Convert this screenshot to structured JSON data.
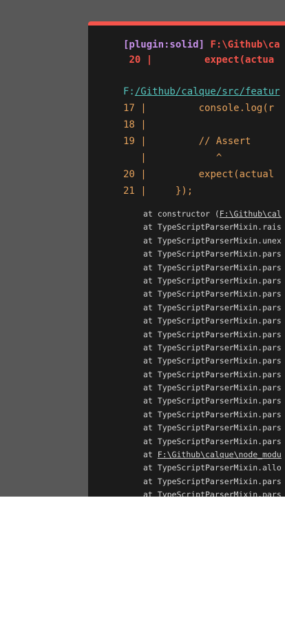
{
  "header": {
    "plugin_tag": "[plugin:solid]",
    "error_path_prefix": "F:\\Github\\ca",
    "error_line_no": "20",
    "error_bar": "|",
    "error_code": "expect(actua"
  },
  "location": {
    "prefix": "F:",
    "link": "/Github/calque/src/featur"
  },
  "frame": [
    {
      "num": "17",
      "bar": "|",
      "code": "        console.log(r"
    },
    {
      "num": "18",
      "bar": "|",
      "code": ""
    },
    {
      "num": "19",
      "bar": "|",
      "code": "        // Assert"
    },
    {
      "num": "",
      "bar": "|",
      "code": "           ^"
    },
    {
      "num": "20",
      "bar": "|",
      "code": "        expect(actual"
    },
    {
      "num": "21",
      "bar": "|",
      "code": "    });"
    }
  ],
  "stack": [
    {
      "pre": "at constructor (",
      "link": "F:\\Github\\cal",
      "post": ""
    },
    {
      "pre": "at TypeScriptParserMixin.rais",
      "link": "",
      "post": ""
    },
    {
      "pre": "at TypeScriptParserMixin.unex",
      "link": "",
      "post": ""
    },
    {
      "pre": "at TypeScriptParserMixin.pars",
      "link": "",
      "post": ""
    },
    {
      "pre": "at TypeScriptParserMixin.pars",
      "link": "",
      "post": ""
    },
    {
      "pre": "at TypeScriptParserMixin.pars",
      "link": "",
      "post": ""
    },
    {
      "pre": "at TypeScriptParserMixin.pars",
      "link": "",
      "post": ""
    },
    {
      "pre": "at TypeScriptParserMixin.pars",
      "link": "",
      "post": ""
    },
    {
      "pre": "at TypeScriptParserMixin.pars",
      "link": "",
      "post": ""
    },
    {
      "pre": "at TypeScriptParserMixin.pars",
      "link": "",
      "post": ""
    },
    {
      "pre": "at TypeScriptParserMixin.pars",
      "link": "",
      "post": ""
    },
    {
      "pre": "at TypeScriptParserMixin.pars",
      "link": "",
      "post": ""
    },
    {
      "pre": "at TypeScriptParserMixin.pars",
      "link": "",
      "post": ""
    },
    {
      "pre": "at TypeScriptParserMixin.pars",
      "link": "",
      "post": ""
    },
    {
      "pre": "at TypeScriptParserMixin.pars",
      "link": "",
      "post": ""
    },
    {
      "pre": "at TypeScriptParserMixin.pars",
      "link": "",
      "post": ""
    },
    {
      "pre": "at TypeScriptParserMixin.pars",
      "link": "",
      "post": ""
    },
    {
      "pre": "at TypeScriptParserMixin.pars",
      "link": "",
      "post": ""
    },
    {
      "pre": "at ",
      "link": "F:\\Github\\calque\\node_modu",
      "post": ""
    },
    {
      "pre": "at TypeScriptParserMixin.allo",
      "link": "",
      "post": ""
    },
    {
      "pre": "at TypeScriptParserMixin.pars",
      "link": "",
      "post": ""
    },
    {
      "pre": "at TypeScriptParserMixin.pars",
      "link": "",
      "post": ""
    }
  ],
  "colors": {
    "backdrop": "#585858",
    "panel": "#1b1b1b",
    "accent_red": "#f5544b",
    "plugin_purple": "#c792ea",
    "frame_orange": "#e5a25c",
    "location_teal": "#56c7c0"
  }
}
